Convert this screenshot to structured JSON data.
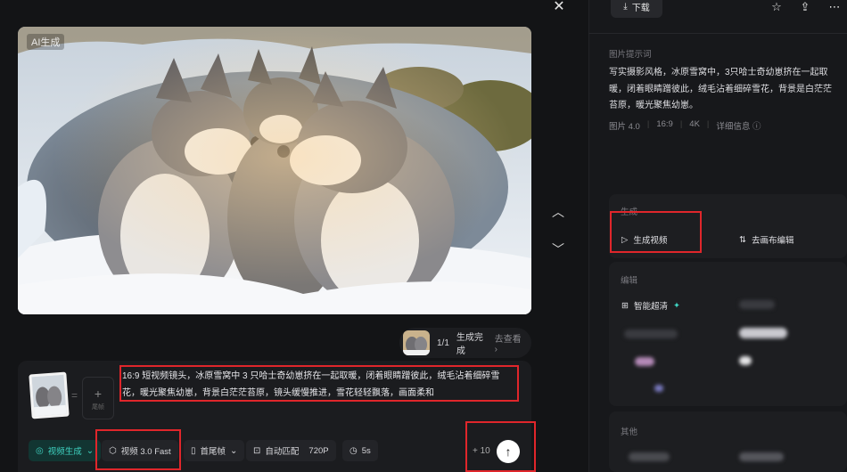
{
  "viewer": {
    "close_icon": "close-icon",
    "ai_badge": "AI生成",
    "nav_up": "chevron-up-icon",
    "nav_down": "chevron-down-icon"
  },
  "status": {
    "count": "1/1",
    "text": "生成完成",
    "link": "去查看 ›"
  },
  "composer": {
    "prompt": "16:9 短视频镜头，冰原雪窝中 3 只哈士奇幼崽挤在一起取暖，闭着眼睛蹭彼此，绒毛沾着细碎雪花，暖光聚焦幼崽，背景白茫茫苔原，镜头缓慢推进，雪花轻轻飘落，画面柔和",
    "add_label": "+",
    "add_sub": "尾帧",
    "equals": "=",
    "mode": "视频生成",
    "model": "视频 3.0 Fast",
    "frames": "首尾帧",
    "ratio": "自动匹配",
    "resolution": "720P",
    "duration": "5s",
    "credits": "+ 10"
  },
  "sidebar": {
    "download": "下载",
    "prompt_title": "图片提示词",
    "prompt": "写实摄影风格，冰原雪窝中，3只哈士奇幼崽挤在一起取暖，闭着眼睛蹭彼此，绒毛沾着细碎雪花，背景是白茫茫苔原，暖光聚焦幼崽。",
    "meta": [
      "图片 4.0",
      "16:9",
      "4K",
      "详细信息 ⓘ"
    ],
    "generate_title": "生成",
    "generate_video": "生成视频",
    "canvas_edit": "去画布编辑",
    "edit_title": "编辑",
    "smart_hd": "智能超清",
    "smart_hd_mark": "✦",
    "other_title": "其他"
  },
  "colors": {
    "accent": "#3fd3c1",
    "highlight": "#e0262b",
    "background": "#131416"
  }
}
